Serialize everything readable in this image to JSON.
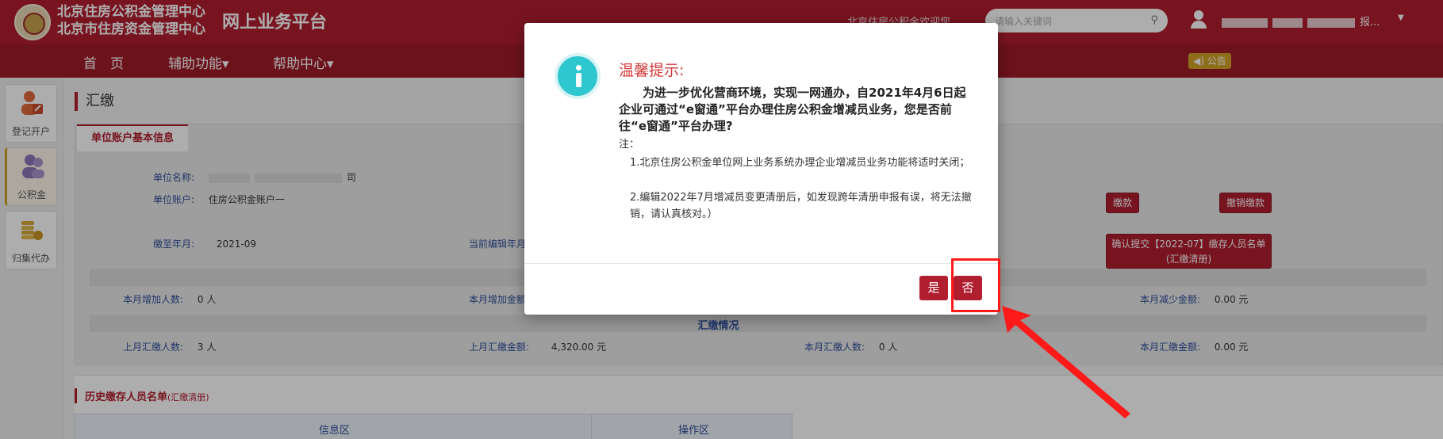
{
  "header": {
    "org_line1": "北京住房公积金管理中心",
    "org_line2": "北京市住房资金管理中心",
    "platform": "网上业务平台",
    "welcome": "北京住房公积金欢迎您",
    "search_placeholder": "请输入关键词",
    "user_suffix": "报..."
  },
  "nav": {
    "items": [
      "首　页",
      "辅助功能▾",
      "帮助中心▾"
    ],
    "notice": "◀) 公告"
  },
  "sidebar": {
    "items": [
      {
        "label": "登记开户",
        "icon": "register-icon"
      },
      {
        "label": "公积金",
        "icon": "people-icon"
      },
      {
        "label": "归集代办",
        "icon": "coins-icon"
      }
    ]
  },
  "main": {
    "page_title": "汇缴",
    "tab": "单位账户基本信息",
    "unit_name_label": "单位名称:",
    "unit_name_suffix": "司",
    "unit_account_label": "单位账户:",
    "unit_account_value": "住房公积金账户一",
    "pay_button": "缴款",
    "cancel_pay_button": "撤销缴款",
    "paid_to_label": "缴至年月:",
    "paid_to_value": "2021-09",
    "editing_month_label": "当前编辑年月",
    "confirm_button_line1": "确认提交【2022-07】缴存人员名单",
    "confirm_button_line2": "(汇缴清册)",
    "added_people_label": "本月增加人数:",
    "added_people_value": "0 人",
    "added_amount_label": "本月增加金额",
    "reduced_amount_label": "本月减少金额:",
    "reduced_amount_value": "0.00 元",
    "summary_title": "汇缴情况",
    "last_people_label": "上月汇缴人数:",
    "last_people_value": "3 人",
    "last_amount_label": "上月汇缴金额:",
    "last_amount_value": "4,320.00 元",
    "this_people_label": "本月汇缴人数:",
    "this_people_value": "0 人",
    "this_amount_label": "本月汇缴金额:",
    "this_amount_value": "0.00 元",
    "history_title": "历史缴存人员名单",
    "history_sub": "(汇缴清册)",
    "grid_info": "信息区",
    "grid_ops": "操作区"
  },
  "modal": {
    "title": "温馨提示:",
    "text": "为进一步优化营商环境，实现一网通办，自2021年4月6日起企业可通过“e窗通”平台办理住房公积金增减员业务，您是否前往“e窗通”平台办理?",
    "note_label": "注：",
    "note1": "1.北京住房公积金单位网上业务系统办理企业增减员业务功能将适时关闭；",
    "note2": "2.编辑2022年7月增减员变更清册后，如发现跨年清册申报有误，将无法撤销，请认真核对。）",
    "yes": "是",
    "no": "否"
  },
  "colors": {
    "brand_red": "#b11e2f",
    "info_cyan": "#2ec6cf",
    "annotation_red": "#ff1a1a"
  }
}
